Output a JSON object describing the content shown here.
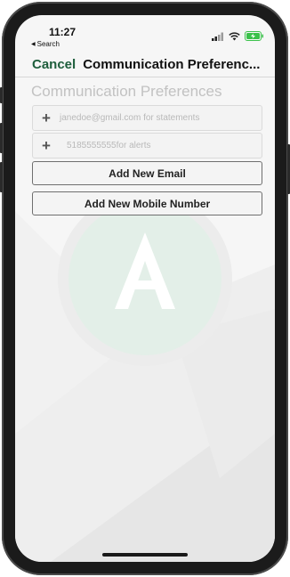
{
  "status_bar": {
    "time": "11:27",
    "back_label": "Search",
    "icons": [
      "cellular-signal-icon",
      "wifi-icon",
      "battery-charging-icon"
    ]
  },
  "nav": {
    "cancel_label": "Cancel",
    "title": "Communication Preferenc..."
  },
  "section": {
    "title": "Communication Preferences"
  },
  "contacts": [
    {
      "value": "janedoe@gmail.com for statements"
    },
    {
      "value": "5185555555for alerts"
    }
  ],
  "actions": {
    "add_email_label": "Add New Email",
    "add_mobile_label": "Add New Mobile Number"
  },
  "colors": {
    "accent": "#1e5e3c",
    "battery": "#3ac14a",
    "watermark_circle": "#e3efe8"
  }
}
